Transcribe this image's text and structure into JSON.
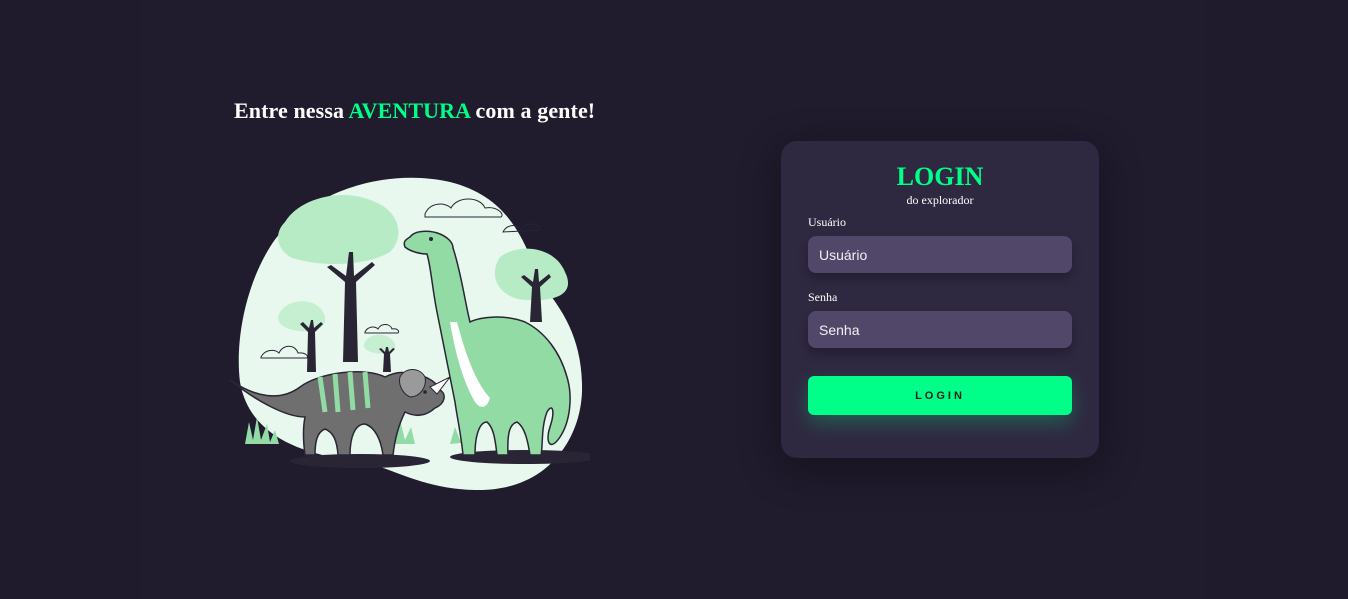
{
  "hero": {
    "headline_pre": "Entre nessa ",
    "headline_accent": "AVENTURA",
    "headline_post": " com a gente!",
    "illustration": "dinosaurs-illustration"
  },
  "login": {
    "title": "LOGIN",
    "subtitle": "do explorador",
    "username_label": "Usuário",
    "username_placeholder": "Usuário",
    "username_value": "",
    "password_label": "Senha",
    "password_placeholder": "Senha",
    "password_value": "",
    "submit_label": "LOGIN"
  },
  "colors": {
    "background": "#201b2c",
    "card": "#2f2841",
    "input": "#514869",
    "accent": "#00ff88",
    "illustration_light": "#e8f8ee",
    "illustration_green": "#92dba5",
    "illustration_mid": "#b7ebc6",
    "triceratops": "#6f6f6f"
  }
}
